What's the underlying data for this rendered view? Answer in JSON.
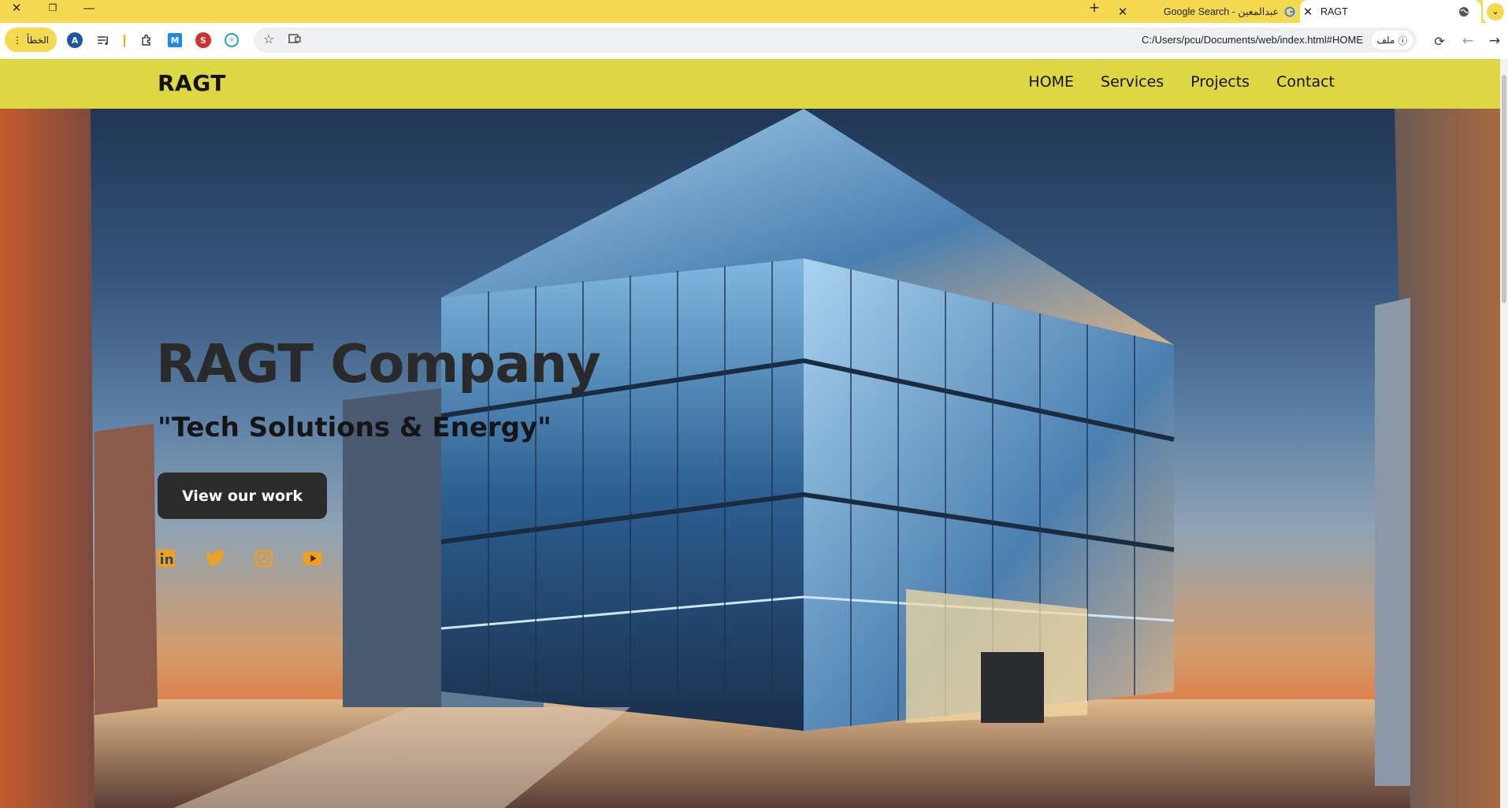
{
  "browser": {
    "tabs": [
      {
        "title": "RAGT",
        "active": true
      },
      {
        "title": "Google Search - عبدالمعين",
        "active": false
      }
    ],
    "toolbar": {
      "error_label": "الخطأ",
      "profile_initial": "A",
      "ext_m": "M",
      "ext_s": "S"
    },
    "address": {
      "url": "C:/Users/pcu/Documents/web/index.html#HOME",
      "site_label": "ملف"
    }
  },
  "site": {
    "logo": "RAGT",
    "nav": [
      "HOME",
      "Services",
      "Projects",
      "Contact"
    ],
    "hero": {
      "title": "RAGT Company",
      "subtitle": "\"Tech Solutions & Energy\"",
      "cta": "View our work"
    },
    "socials": [
      "linkedin-icon",
      "twitter-icon",
      "instagram-icon",
      "youtube-icon"
    ],
    "colors": {
      "header_bg": "#dcd742",
      "browser_accent": "#f5d94e",
      "social_icon": "#f0a020",
      "cta_bg": "#2b2b2b"
    }
  }
}
